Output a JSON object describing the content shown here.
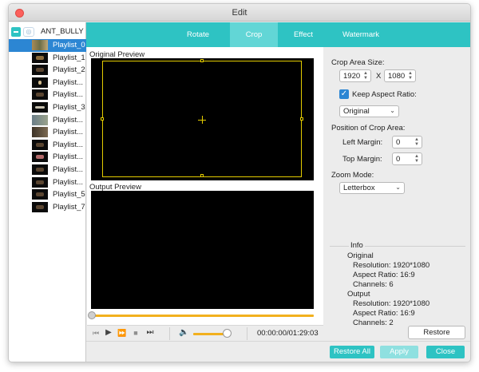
{
  "window": {
    "title": "Edit"
  },
  "sidebar": {
    "folder": "ANT_BULLY",
    "items": [
      {
        "label": "Playlist_0",
        "selected": true
      },
      {
        "label": "Playlist_1"
      },
      {
        "label": "Playlist_2"
      },
      {
        "label": "Playlist..."
      },
      {
        "label": "Playlist..."
      },
      {
        "label": "Playlist_3"
      },
      {
        "label": "Playlist..."
      },
      {
        "label": "Playlist..."
      },
      {
        "label": "Playlist..."
      },
      {
        "label": "Playlist..."
      },
      {
        "label": "Playlist..."
      },
      {
        "label": "Playlist..."
      },
      {
        "label": "Playlist_5"
      },
      {
        "label": "Playlist_7"
      }
    ]
  },
  "tabs": [
    {
      "label": "Rotate"
    },
    {
      "label": "Crop",
      "active": true
    },
    {
      "label": "Effect"
    },
    {
      "label": "Watermark"
    }
  ],
  "preview": {
    "original_label": "Original Preview",
    "output_label": "Output Preview",
    "timecode": "00:00:00/01:29:03",
    "volume_level": 0.93,
    "seek_position": 0.0
  },
  "crop": {
    "area_size_label": "Crop Area Size:",
    "width": "1920",
    "x_label": "X",
    "height": "1080",
    "keep_aspect_label": "Keep Aspect Ratio:",
    "keep_aspect_checked": true,
    "aspect_value": "Original",
    "position_label": "Position of Crop Area:",
    "left_margin_label": "Left Margin:",
    "left_margin": "0",
    "top_margin_label": "Top Margin:",
    "top_margin": "0",
    "zoom_mode_label": "Zoom Mode:",
    "zoom_mode_value": "Letterbox"
  },
  "info": {
    "title": "Info",
    "original_title": "Original",
    "original_resolution": "Resolution: 1920*1080",
    "original_aspect": "Aspect Ratio: 16:9",
    "original_channels": "Channels: 6",
    "output_title": "Output",
    "output_resolution": "Resolution: 1920*1080",
    "output_aspect": "Aspect Ratio: 16:9",
    "output_channels": "Channels: 2"
  },
  "buttons": {
    "restore_defaults": "Restore Defaults",
    "restore_all": "Restore All",
    "apply": "Apply",
    "close": "Close"
  },
  "colors": {
    "accent": "#2ec3c3",
    "selection": "#2c86d3",
    "crop_frame": "#e4cc00",
    "slider": "#f2b01e"
  }
}
